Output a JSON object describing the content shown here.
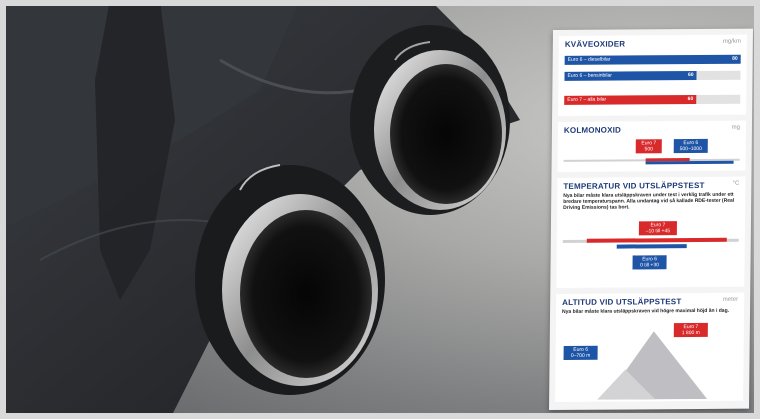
{
  "colors": {
    "red": "#d8292b",
    "blue": "#1f55a6",
    "title": "#1d3a78"
  },
  "nox": {
    "title": "KVÄVEOXIDER",
    "unit": "mg/km",
    "bars": [
      {
        "label": "Euro 6 – dieselbilar",
        "value": "80",
        "color": "blue",
        "fraction": 1.0
      },
      {
        "label": "Euro 6 – bensinbilar",
        "value": "60",
        "color": "blue",
        "fraction": 0.75
      },
      {
        "label": "Euro 7 – alla bilar",
        "value": "60",
        "color": "red",
        "fraction": 0.75
      }
    ]
  },
  "co": {
    "title": "KOLMONOXID",
    "unit": "mg",
    "euro7": {
      "name": "Euro 7",
      "value": "500"
    },
    "euro6": {
      "name": "Euro 6",
      "value": "500–1000"
    }
  },
  "temp": {
    "title": "TEMPERATUR VID UTSLÄPPSTEST",
    "unit": "°C",
    "note": "Nya bilar måste klara utsläppskraven under test i verklig trafik under ett bredare temperaturspann. Alla undantag vid så kallade RDE-tester (Real Driving Emissions) tas bort.",
    "euro7": {
      "name": "Euro 7",
      "value": "–10 till +45"
    },
    "euro6": {
      "name": "Euro 6",
      "value": "0 till +30"
    }
  },
  "alt": {
    "title": "ALTITUD VID UTSLÄPPSTEST",
    "unit": "meter",
    "note": "Nya bilar måste klara utsläppskraven vid högre maximal höjd än i dag.",
    "euro7": {
      "name": "Euro 7",
      "value": "1 800 m"
    },
    "euro6": {
      "name": "Euro 6",
      "value": "0–700 m"
    }
  }
}
